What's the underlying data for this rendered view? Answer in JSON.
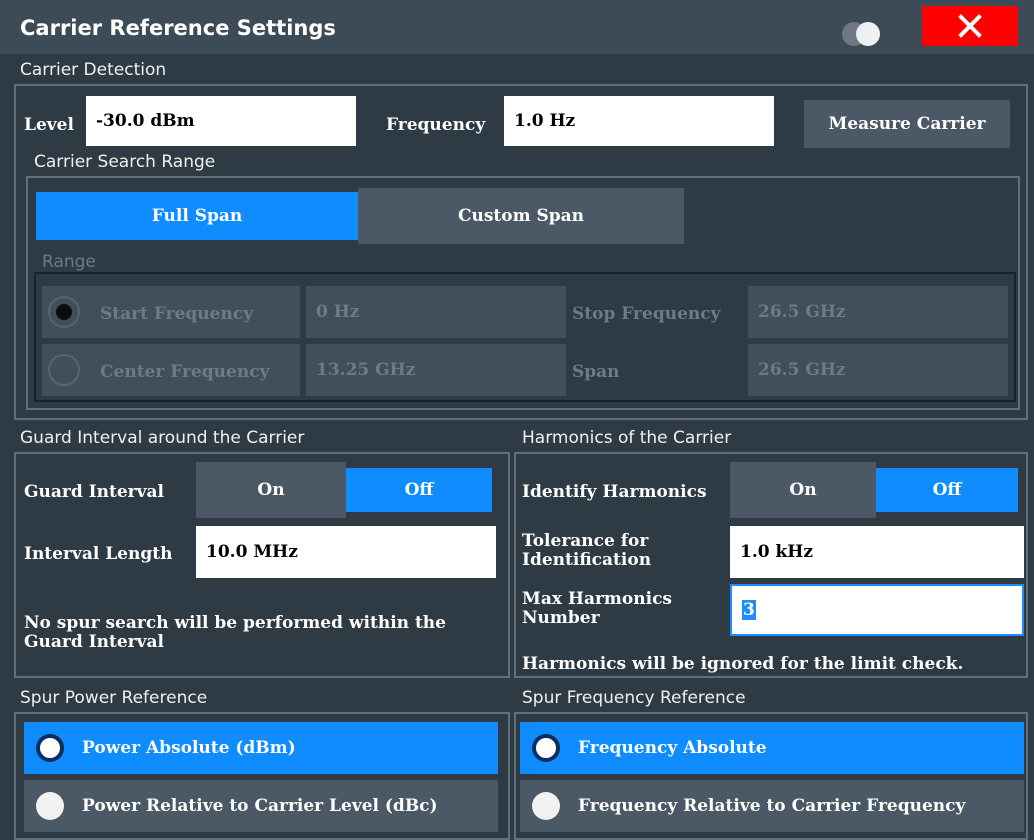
{
  "dialog": {
    "title": "Carrier Reference Settings"
  },
  "carrier_detection": {
    "label": "Carrier Detection",
    "level_label": "Level",
    "level_value": "-30.0 dBm",
    "frequency_label": "Frequency",
    "frequency_value": "1.0 Hz",
    "measure_button": "Measure Carrier"
  },
  "search_range": {
    "label": "Carrier Search Range",
    "full_span": "Full Span",
    "custom_span": "Custom Span",
    "selected": "Full Span",
    "range_label": "Range",
    "start_frequency_label": "Start Frequency",
    "start_frequency_value": "0 Hz",
    "stop_frequency_label": "Stop Frequency",
    "stop_frequency_value": "26.5 GHz",
    "center_frequency_label": "Center Frequency",
    "center_frequency_value": "13.25 GHz",
    "span_label": "Span",
    "span_value": "26.5 GHz"
  },
  "guard": {
    "label": "Guard Interval around the Carrier",
    "guard_interval_label": "Guard Interval",
    "on": "On",
    "off": "Off",
    "selected": "Off",
    "interval_length_label": "Interval Length",
    "interval_length_value": "10.0 MHz",
    "note_line1": "No spur search will be performed within the",
    "note_line2": "Guard Interval"
  },
  "harmonics": {
    "label": "Harmonics of the Carrier",
    "identify_label": "Identify Harmonics",
    "on": "On",
    "off": "Off",
    "selected": "Off",
    "tolerance_label_line1": "Tolerance for",
    "tolerance_label_line2": "Identification",
    "tolerance_value": "1.0 kHz",
    "max_label_line1": "Max Harmonics",
    "max_label_line2": "Number",
    "max_value": "3",
    "note": "Harmonics will be ignored for the limit check."
  },
  "spur_power": {
    "label": "Spur Power Reference",
    "option_absolute": "Power Absolute (dBm)",
    "option_relative": "Power Relative to Carrier Level (dBc)",
    "selected": "Power Absolute (dBm)"
  },
  "spur_frequency": {
    "label": "Spur Frequency Reference",
    "option_absolute": "Frequency Absolute",
    "option_relative": "Frequency Relative to Carrier Frequency",
    "selected": "Frequency Absolute"
  },
  "colors": {
    "accent": "#0f8cff",
    "close": "#ff0000",
    "button": "#4a5965",
    "background": "#2e3a44"
  }
}
